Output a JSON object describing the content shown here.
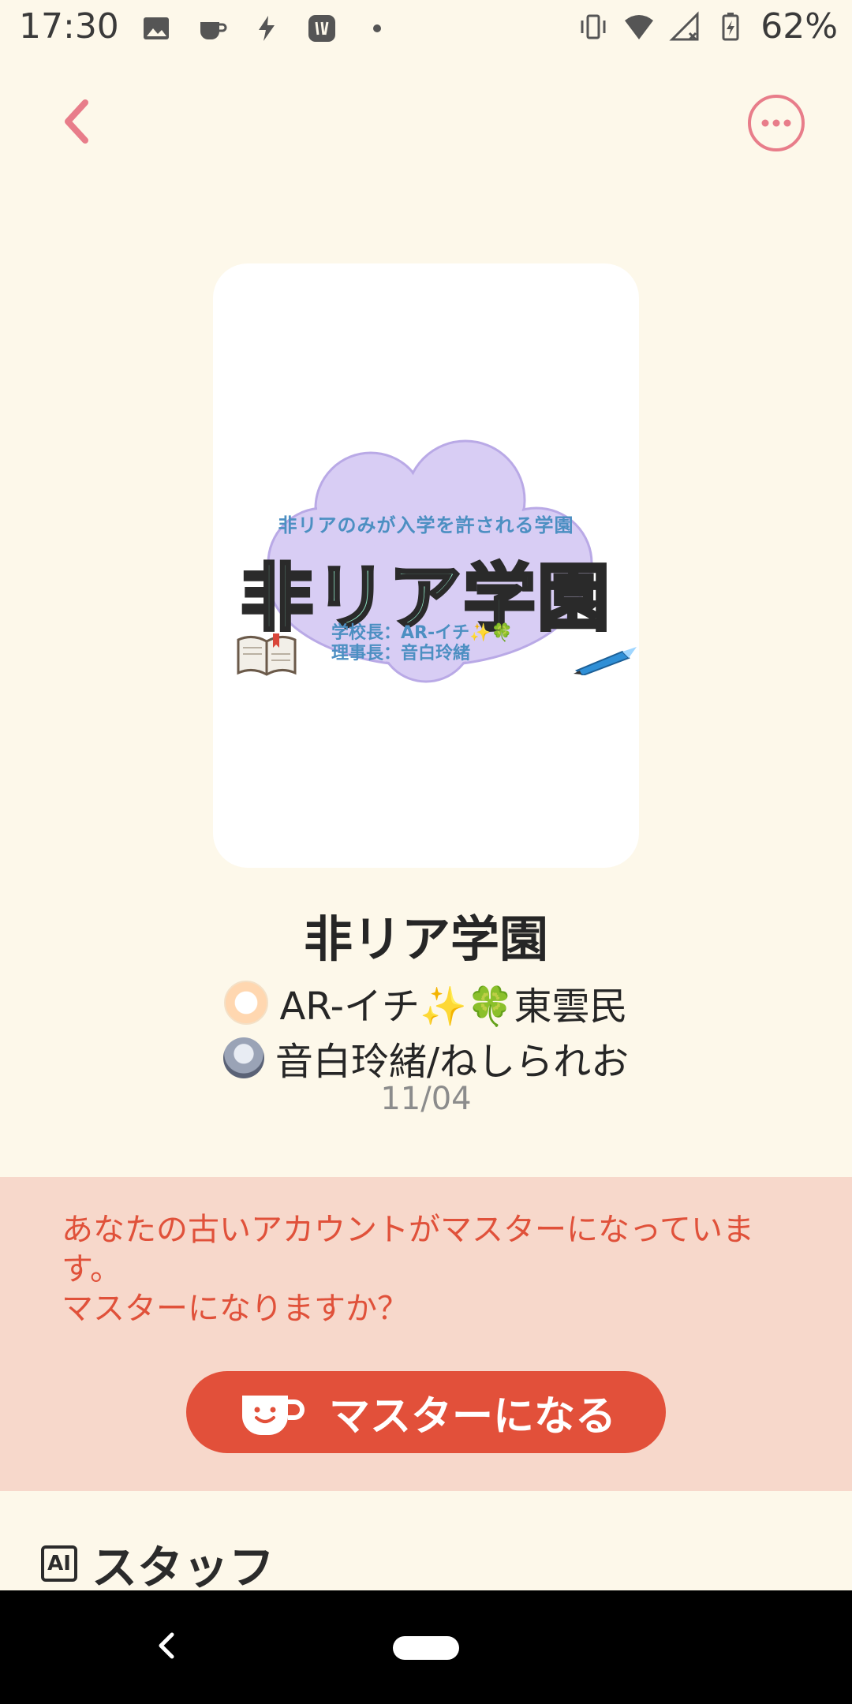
{
  "status_bar": {
    "time": "17:30",
    "battery_percent": "62%",
    "icons_left": [
      "image-icon",
      "cup-icon",
      "bolt-icon",
      "app-icon",
      "dot-icon"
    ],
    "icons_right": [
      "vibrate-icon",
      "wifi-icon",
      "signal-icon",
      "battery-icon"
    ]
  },
  "header": {
    "back_icon": "chevron-left-icon",
    "more_icon": "more-icon"
  },
  "cover": {
    "logo_subtitle": "非リアのみが入学を許される学園",
    "logo_title": "非リア学園",
    "logo_credit_1": "学校長：AR-イチ✨🍀",
    "logo_credit_2": "理事長：音白玲緒"
  },
  "title": "非リア学園",
  "creators": [
    {
      "name": "AR-イチ✨🍀東雲民"
    },
    {
      "name": "音白玲緒/ねしられお"
    }
  ],
  "date": "11/04",
  "notice": {
    "message_line1": "あなたの古いアカウントがマスターになっていま",
    "message_line2": "す。",
    "message_line3": "マスターになりますか？",
    "button_label": "マスターになる"
  },
  "staff_section": {
    "badge": "AI",
    "label": "スタッフ"
  },
  "colors": {
    "background": "#fdf8ea",
    "accent": "#e2503a",
    "notice_bg": "#f7d8cb",
    "icon_pink": "#e87d8a"
  }
}
